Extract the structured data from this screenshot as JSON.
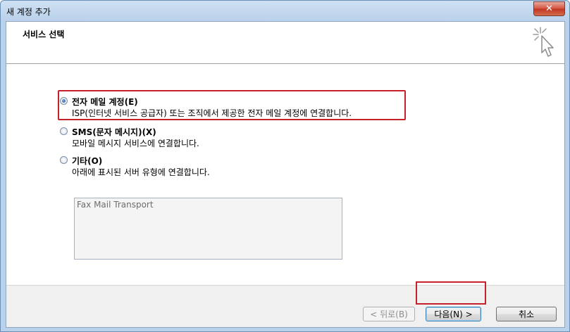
{
  "window": {
    "title": "새 계정 추가",
    "close_label": "✕"
  },
  "header": {
    "title": "서비스 선택"
  },
  "options": [
    {
      "label": "전자 메일 계정(E)",
      "description": "ISP(인터넷 서비스 공급자) 또는 조직에서 제공한 전자 메일 계정에 연결합니다.",
      "selected": true
    },
    {
      "label": "SMS(문자 메시지)(X)",
      "description": "모바일 메시지 서비스에 연결합니다.",
      "selected": false
    },
    {
      "label": "기타(O)",
      "description": "아래에 표시된 서버 유형에 연결합니다.",
      "selected": false
    }
  ],
  "server_types": [
    "Fax Mail Transport"
  ],
  "buttons": {
    "back": "< 뒤로(B)",
    "next": "다음(N) >",
    "cancel": "취소"
  }
}
